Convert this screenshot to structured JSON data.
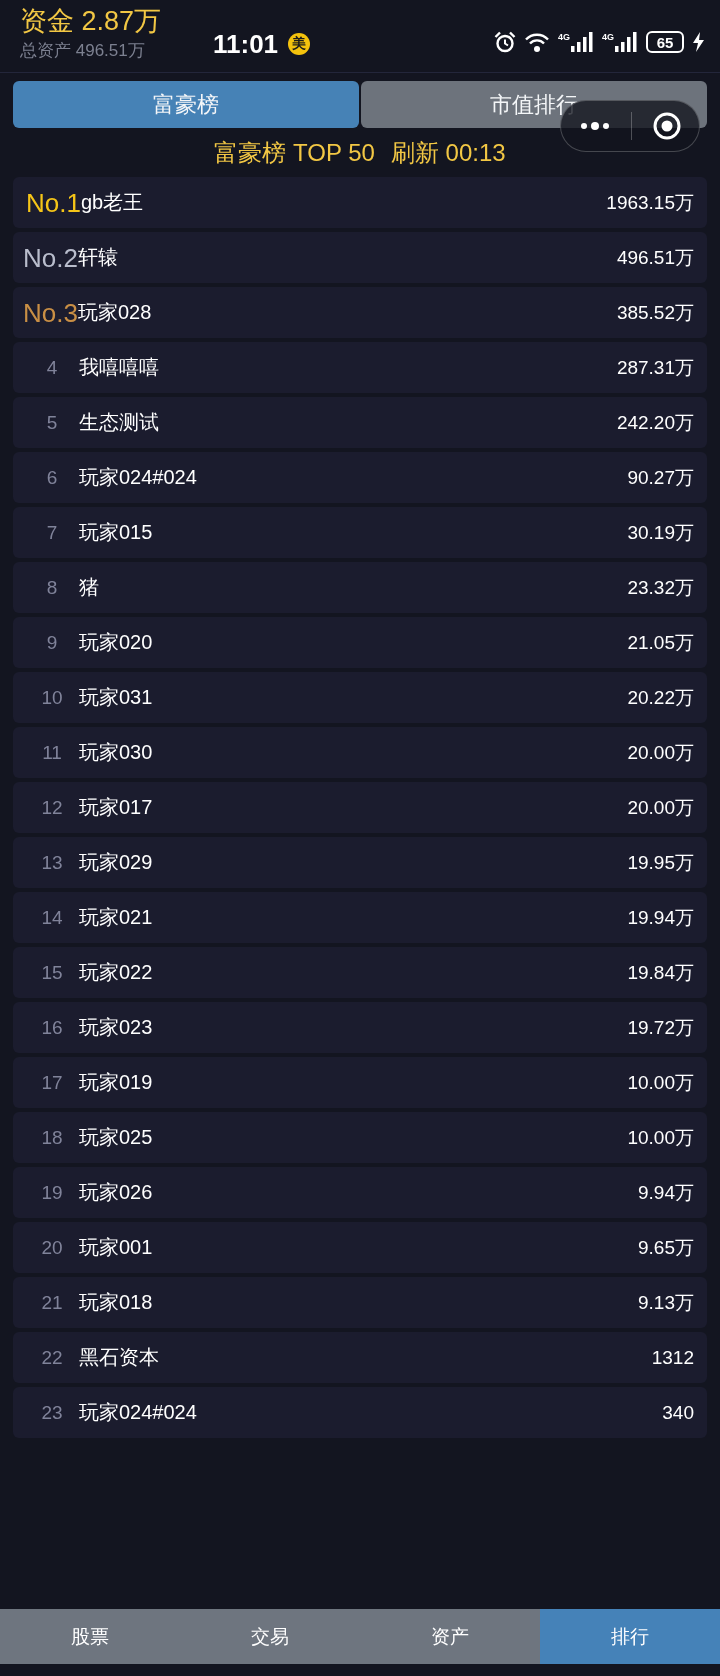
{
  "header": {
    "funds": "资金 2.87万",
    "total_assets": "总资产 496.51万"
  },
  "status_bar": {
    "time": "11:01",
    "badge": "美",
    "network_labels": [
      "4G",
      "4G"
    ],
    "battery": "65"
  },
  "tabs": [
    {
      "label": "富豪榜",
      "selected": true
    },
    {
      "label": "市值排行",
      "selected": false
    }
  ],
  "ranking_header": {
    "title": "富豪榜 TOP 50",
    "refresh": "刷新 00:13"
  },
  "rows": [
    {
      "kind": "gold",
      "rank": "No.1",
      "name": "gb老王",
      "value": "1963.15万"
    },
    {
      "kind": "silver",
      "rank": "No.2",
      "name": "轩辕",
      "value": "496.51万"
    },
    {
      "kind": "bronze",
      "rank": "No.3",
      "name": "玩家028",
      "value": "385.52万"
    },
    {
      "kind": "number",
      "rank": "4",
      "name": "我嘻嘻嘻",
      "value": "287.31万"
    },
    {
      "kind": "number",
      "rank": "5",
      "name": "生态测试",
      "value": "242.20万"
    },
    {
      "kind": "number",
      "rank": "6",
      "name": "玩家024#024",
      "value": "90.27万"
    },
    {
      "kind": "number",
      "rank": "7",
      "name": "玩家015",
      "value": "30.19万"
    },
    {
      "kind": "number",
      "rank": "8",
      "name": "猪",
      "value": "23.32万"
    },
    {
      "kind": "number",
      "rank": "9",
      "name": "玩家020",
      "value": "21.05万"
    },
    {
      "kind": "number",
      "rank": "10",
      "name": "玩家031",
      "value": "20.22万"
    },
    {
      "kind": "number",
      "rank": "11",
      "name": "玩家030",
      "value": "20.00万"
    },
    {
      "kind": "number",
      "rank": "12",
      "name": "玩家017",
      "value": "20.00万"
    },
    {
      "kind": "number",
      "rank": "13",
      "name": "玩家029",
      "value": "19.95万"
    },
    {
      "kind": "number",
      "rank": "14",
      "name": "玩家021",
      "value": "19.94万"
    },
    {
      "kind": "number",
      "rank": "15",
      "name": "玩家022",
      "value": "19.84万"
    },
    {
      "kind": "number",
      "rank": "16",
      "name": "玩家023",
      "value": "19.72万"
    },
    {
      "kind": "number",
      "rank": "17",
      "name": "玩家019",
      "value": "10.00万"
    },
    {
      "kind": "number",
      "rank": "18",
      "name": "玩家025",
      "value": "10.00万"
    },
    {
      "kind": "number",
      "rank": "19",
      "name": "玩家026",
      "value": "9.94万"
    },
    {
      "kind": "number",
      "rank": "20",
      "name": "玩家001",
      "value": "9.65万"
    },
    {
      "kind": "number",
      "rank": "21",
      "name": "玩家018",
      "value": "9.13万"
    },
    {
      "kind": "number",
      "rank": "22",
      "name": "黑石资本",
      "value": "1312"
    },
    {
      "kind": "number",
      "rank": "23",
      "name": "玩家024#024",
      "value": "340"
    }
  ],
  "bottom_nav": [
    {
      "label": "股票",
      "selected": false
    },
    {
      "label": "交易",
      "selected": false
    },
    {
      "label": "资产",
      "selected": false
    },
    {
      "label": "排行",
      "selected": true
    }
  ]
}
